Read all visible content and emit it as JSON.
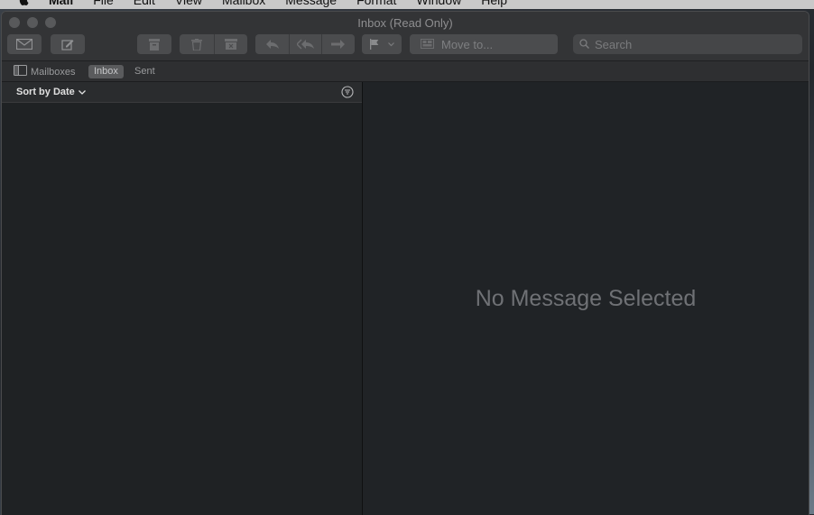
{
  "menubar": {
    "app_name": "Mail",
    "items": [
      "File",
      "Edit",
      "View",
      "Mailbox",
      "Message",
      "Format",
      "Window",
      "Help"
    ]
  },
  "window": {
    "title": "Inbox (Read Only)"
  },
  "toolbar": {
    "move_to_label": "Move to...",
    "search_placeholder": "Search"
  },
  "favorites": {
    "mailboxes_label": "Mailboxes",
    "inbox_label": "Inbox",
    "sent_label": "Sent"
  },
  "message_list": {
    "sort_label": "Sort by Date"
  },
  "message_viewer": {
    "empty_text": "No Message Selected"
  }
}
